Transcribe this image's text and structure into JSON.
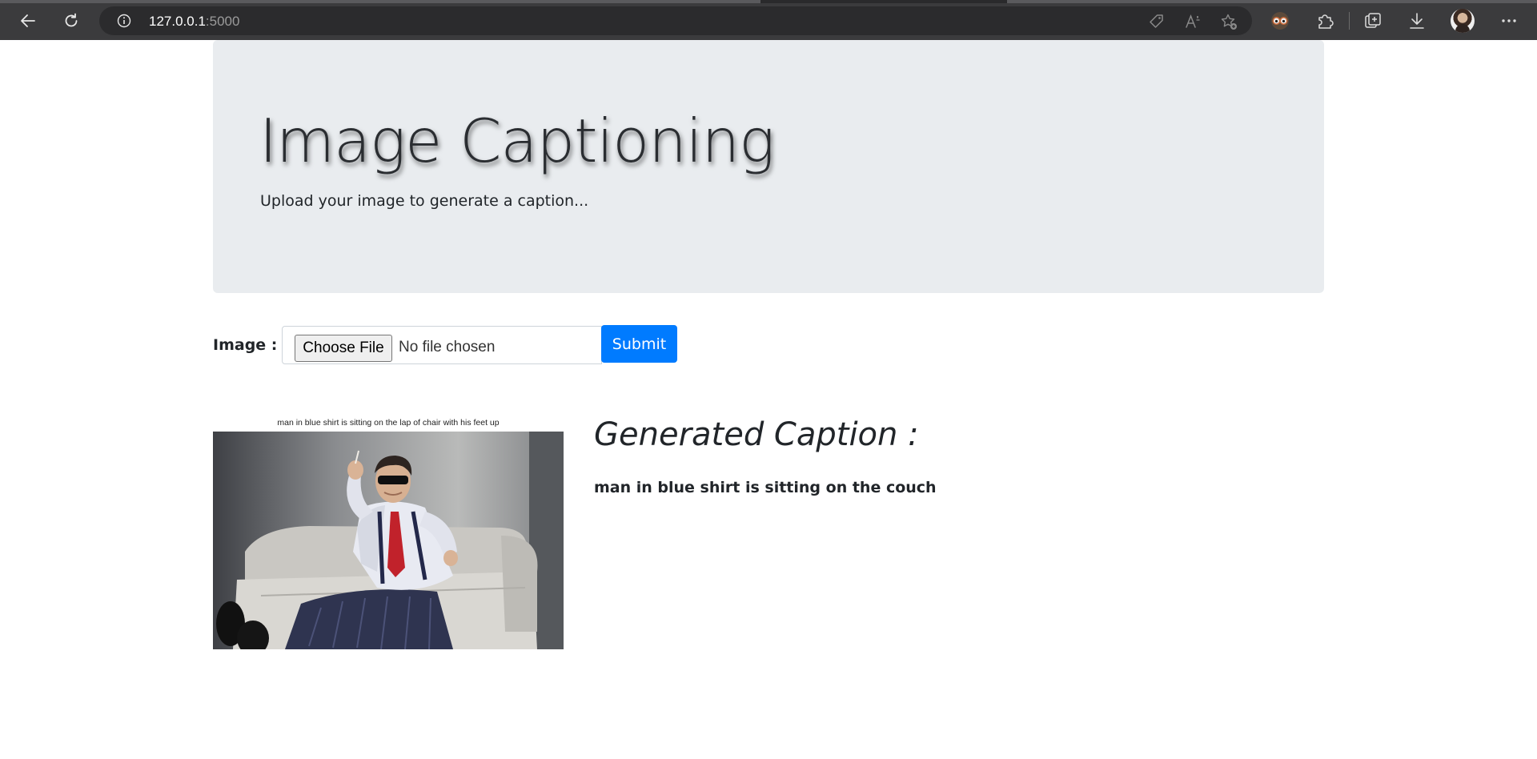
{
  "browser": {
    "url_host": "127.0.0.1",
    "url_port": ":5000",
    "icons": {
      "back": "back-arrow-icon",
      "refresh": "refresh-icon",
      "site_info": "info-icon",
      "shopping": "tag-icon",
      "read_aloud": "read-aloud-icon",
      "favorites": "favorite-star-icon",
      "extension_profile": "extension-glasses-icon",
      "extensions": "puzzle-icon",
      "collections": "collections-icon",
      "downloads": "download-icon",
      "profile": "avatar",
      "menu": "more-icon"
    }
  },
  "jumbotron": {
    "title": "Image Captioning",
    "subtitle": "Upload your image to generate a caption..."
  },
  "form": {
    "label": "Image :",
    "choose_file_label": "Choose File",
    "file_status": "No file chosen",
    "submit_label": "Submit"
  },
  "result": {
    "image_caption_overlay": "man in blue shirt is sitting on the lap of chair with his feet up",
    "heading": "Generated Caption :",
    "caption": "man in blue shirt is sitting on the couch"
  },
  "colors": {
    "chrome_bg": "#3b3b3d",
    "jumbotron_bg": "#e9ecef",
    "submit_bg": "#007bff",
    "text": "#212529"
  }
}
